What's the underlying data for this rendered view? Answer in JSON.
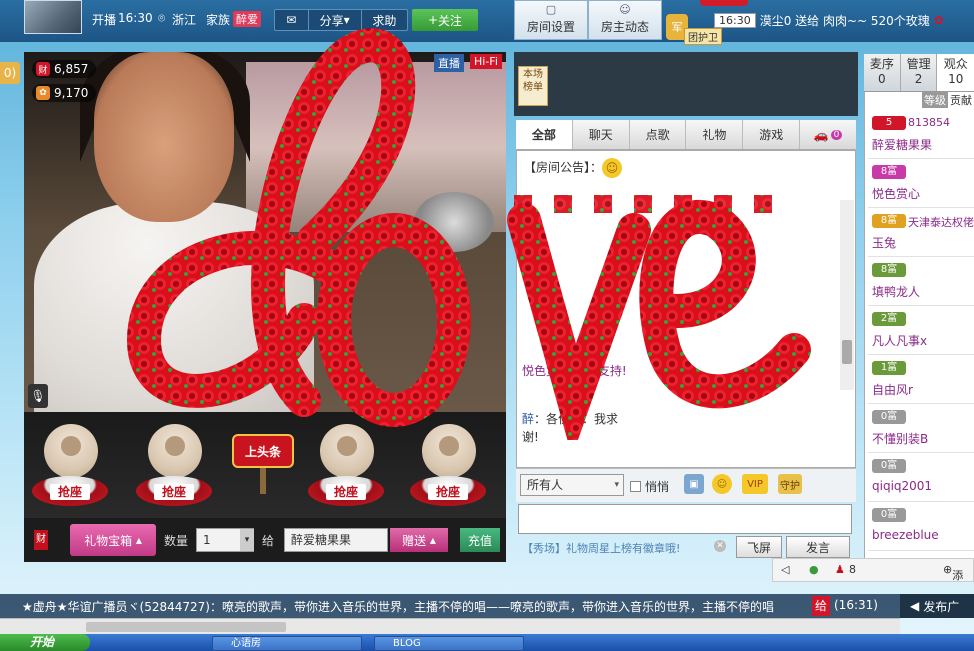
{
  "topbar": {
    "live_label": "开播",
    "live_time": "16:30",
    "location": "浙江",
    "family_label": "家族",
    "family_name": "醉爱",
    "share": "分享",
    "help": "求助",
    "follow": "关注",
    "room_settings": "房间设置",
    "host_news": "房主动态",
    "guard_label": "团护卫",
    "ticker_time": "16:30",
    "ticker_text": "漠尘0 送给 肉肉~~ 520个玫瑰"
  },
  "video": {
    "wealth_count": "6,857",
    "charm_count": "9,170",
    "live_badge": "直播",
    "hifi_badge": "Hi-Fi"
  },
  "seats": {
    "grab_label": "抢座",
    "headline": "上头条"
  },
  "giftbar": {
    "cai": "财",
    "gift_box": "礼物宝箱",
    "qty_label": "数量",
    "qty_value": "1",
    "give_label": "给",
    "recipient": "醉爱糖果果",
    "send": "赠送",
    "recharge": "充值"
  },
  "chat": {
    "rank_tag": "本场榜单",
    "tabs": [
      "全部",
      "聊天",
      "点歌",
      "礼物",
      "游戏"
    ],
    "car_count": "0",
    "announcement": "【房间公告】：",
    "msg1": "悦色赏心 ……支持!",
    "msg2_name": "醉",
    "msg2_text": "：各位亲：我求",
    "msg2_tail": "谢!",
    "to_select": "所有人",
    "whisper": "悄悄",
    "vip": "VIP",
    "guard": "守护",
    "sys_note": "【秀场】礼物周星上榜有徽章哦!",
    "flyscreen": "飞屏",
    "speak": "发言"
  },
  "userlist": {
    "tabs": [
      {
        "label": "麦序",
        "count": "0"
      },
      {
        "label": "管理",
        "count": "2"
      },
      {
        "label": "观众",
        "count": "10"
      }
    ],
    "head_level": "等级",
    "head_contrib": "贡献",
    "users": [
      {
        "badge": "5",
        "extra": "813854",
        "name": "醉爱糖果果",
        "badge_color": "#d2162a"
      },
      {
        "badge": "8富",
        "extra": "",
        "name": "悦色赏心",
        "badge_color": "#c83aa8"
      },
      {
        "badge": "8富",
        "extra": "天津泰达权佬",
        "name": "玉兔",
        "badge_color": "#e0a020"
      },
      {
        "badge": "8富",
        "extra": "",
        "name": "填鸭龙人",
        "badge_color": "#6a9a3a"
      },
      {
        "badge": "2富",
        "extra": "",
        "name": "凡人凡事x",
        "badge_color": "#6a9a3a"
      },
      {
        "badge": "1富",
        "extra": "",
        "name": "自由风r",
        "badge_color": "#6a9a3a"
      },
      {
        "badge": "0富",
        "extra": "",
        "name": "不懂别装B",
        "badge_color": "#999999"
      },
      {
        "badge": "0富",
        "extra": "",
        "name": "qiqiq2001",
        "badge_color": "#999999"
      },
      {
        "badge": "0富",
        "extra": "",
        "name": "breezeblue",
        "badge_color": "#999999"
      }
    ],
    "footer_count": "8",
    "footer_add": "添"
  },
  "broadcast": {
    "text": "★虚舟★华谊广播员ヾ(52844727)：嘹亮的歌声，带你进入音乐的世界，主播不停的唱——嘹亮的歌声，带你进入音乐的世界，主播不停的唱",
    "gift_char": "给",
    "time": "(16:31)",
    "publish": "发布广"
  },
  "taskbar": {
    "start": "开始",
    "items": [
      "",
      "心语房",
      "BLOG"
    ]
  },
  "colors": {
    "accent": "#2a6fa2",
    "rose": "#d2162a",
    "pink_button": "#c23a86",
    "green_button": "#369b35"
  }
}
